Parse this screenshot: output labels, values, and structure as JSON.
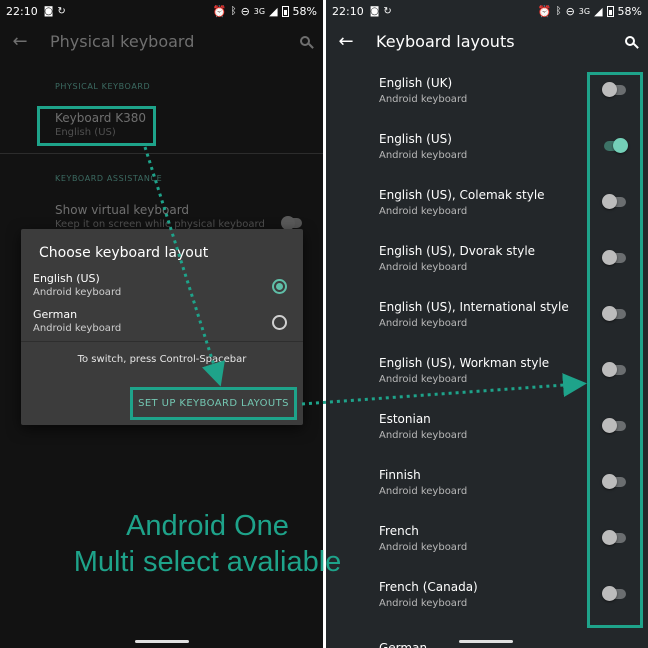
{
  "statusbar": {
    "time": "22:10",
    "network": "3G",
    "battery": "58%"
  },
  "left": {
    "title": "Physical keyboard",
    "section_physical": "PHYSICAL KEYBOARD",
    "keyboard_name": "Keyboard K380",
    "keyboard_sub": "English (US)",
    "section_assist": "KEYBOARD ASSISTANCE",
    "virtual_title": "Show virtual keyboard",
    "virtual_sub": "Keep it on screen while physical keyboard",
    "dialog": {
      "title": "Choose keyboard layout",
      "options": [
        {
          "title": "English (US)",
          "sub": "Android keyboard",
          "selected": true
        },
        {
          "title": "German",
          "sub": "Android keyboard",
          "selected": false
        }
      ],
      "hint": "To switch, press Control-Spacebar",
      "button": "SET UP KEYBOARD LAYOUTS"
    }
  },
  "right": {
    "title": "Keyboard layouts",
    "items": [
      {
        "title": "English (UK)",
        "sub": "Android keyboard",
        "on": false
      },
      {
        "title": "English (US)",
        "sub": "Android keyboard",
        "on": true
      },
      {
        "title": "English (US), Colemak style",
        "sub": "Android keyboard",
        "on": false
      },
      {
        "title": "English (US), Dvorak style",
        "sub": "Android keyboard",
        "on": false
      },
      {
        "title": "English (US), International style",
        "sub": "Android keyboard",
        "on": false
      },
      {
        "title": "English (US), Workman style",
        "sub": "Android keyboard",
        "on": false
      },
      {
        "title": "Estonian",
        "sub": "Android keyboard",
        "on": false
      },
      {
        "title": "Finnish",
        "sub": "Android keyboard",
        "on": false
      },
      {
        "title": "French",
        "sub": "Android keyboard",
        "on": false
      },
      {
        "title": "French (Canada)",
        "sub": "Android keyboard",
        "on": false
      }
    ],
    "partial_item": "German"
  },
  "caption": {
    "line1": "Android One",
    "line2": "Multi select avaliable"
  },
  "colors": {
    "accent": "#1ea38a",
    "switch_on": "#74d0b8",
    "left_bg": "#121212",
    "right_bg": "#23272a",
    "dialog_bg": "#3c3c3c"
  }
}
